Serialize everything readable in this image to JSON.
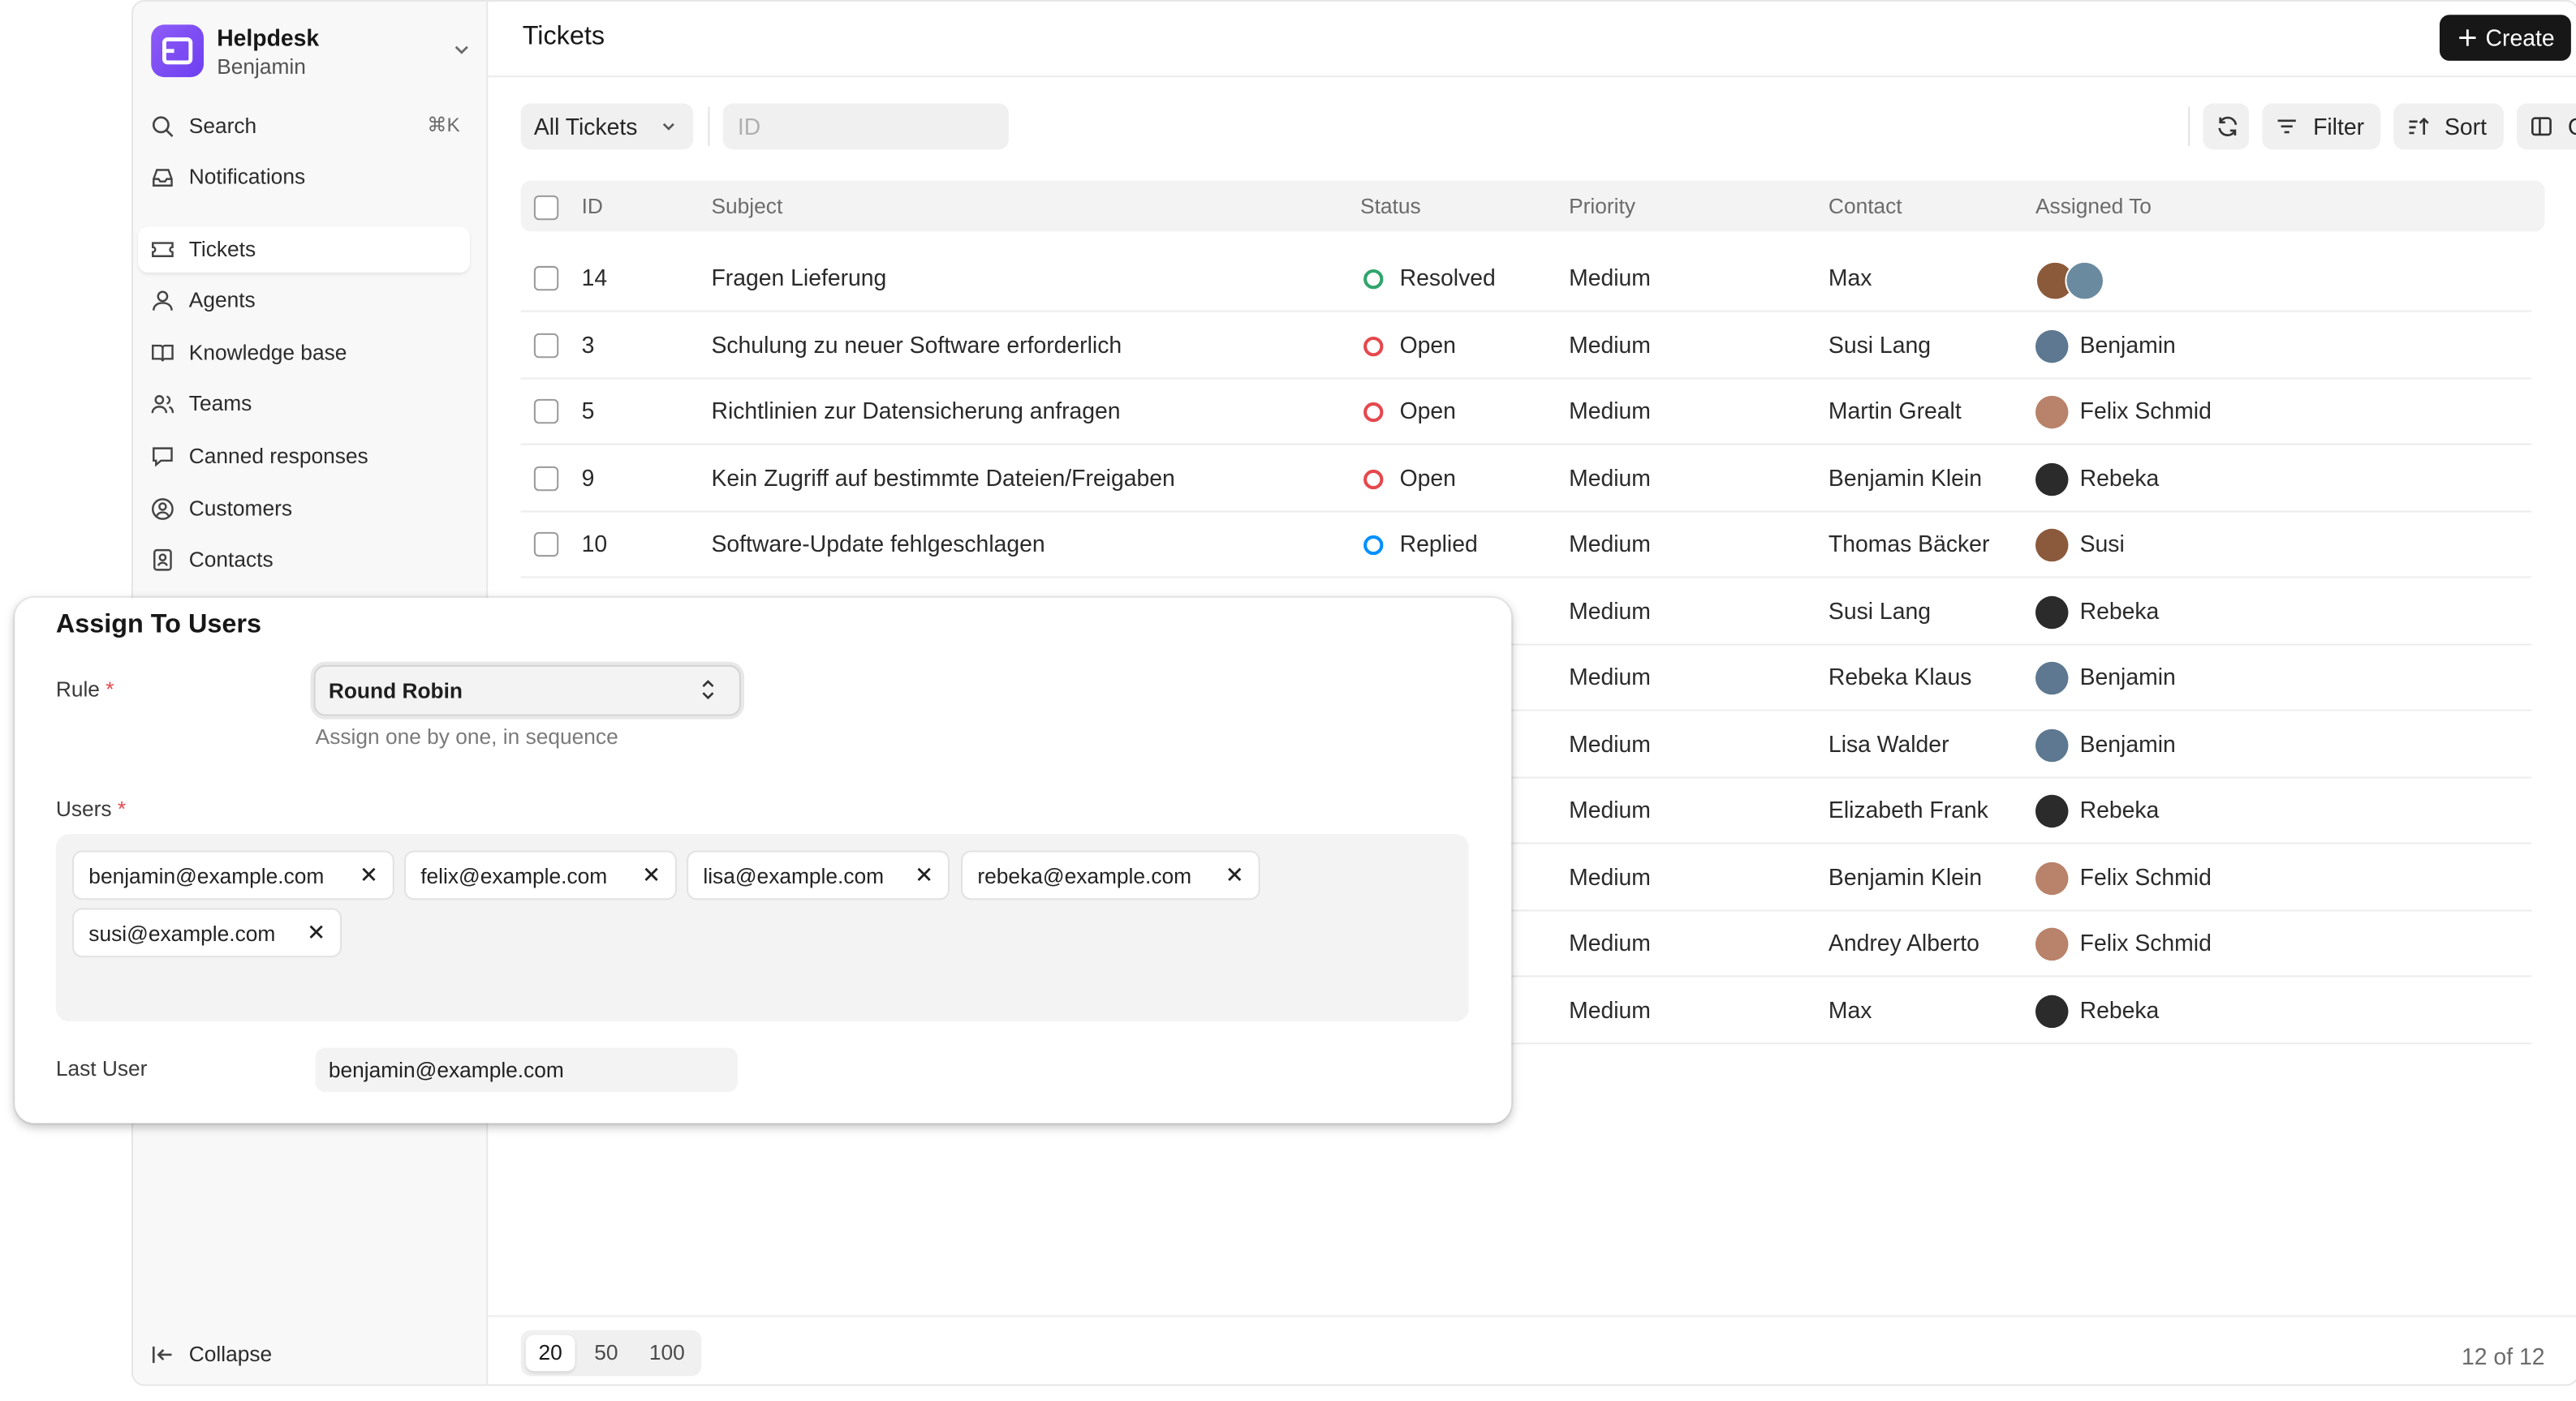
{
  "sidebar": {
    "app_name": "Helpdesk",
    "user_name": "Benjamin",
    "search_label": "Search",
    "search_shortcut": "⌘K",
    "items": [
      {
        "label": "Notifications",
        "icon": "inbox-icon"
      },
      {
        "label": "Tickets",
        "icon": "ticket-icon",
        "active": true
      },
      {
        "label": "Agents",
        "icon": "user-icon"
      },
      {
        "label": "Knowledge base",
        "icon": "book-icon"
      },
      {
        "label": "Teams",
        "icon": "users-icon"
      },
      {
        "label": "Canned responses",
        "icon": "message-icon"
      },
      {
        "label": "Customers",
        "icon": "user-circle-icon"
      },
      {
        "label": "Contacts",
        "icon": "contact-icon"
      }
    ],
    "collapse_label": "Collapse"
  },
  "header": {
    "title": "Tickets",
    "create_label": "Create"
  },
  "toolbar": {
    "view_label": "All Tickets",
    "id_placeholder": "ID",
    "filter_label": "Filter",
    "sort_label": "Sort",
    "columns_label": "Columns"
  },
  "table": {
    "columns": [
      "ID",
      "Subject",
      "Status",
      "Priority",
      "Contact",
      "Assigned To"
    ],
    "rows": [
      {
        "id": "14",
        "subject": "Fragen Lieferung",
        "status": "Resolved",
        "priority": "Medium",
        "contact": "Max",
        "assigned": ""
      },
      {
        "id": "3",
        "subject": "Schulung zu neuer Software erforderlich",
        "status": "Open",
        "priority": "Medium",
        "contact": "Susi Lang",
        "assigned": "Benjamin"
      },
      {
        "id": "5",
        "subject": "Richtlinien zur Datensicherung anfragen",
        "status": "Open",
        "priority": "Medium",
        "contact": "Martin Grealt",
        "assigned": "Felix Schmid"
      },
      {
        "id": "9",
        "subject": "Kein Zugriff auf bestimmte Dateien/Freigaben",
        "status": "Open",
        "priority": "Medium",
        "contact": "Benjamin Klein",
        "assigned": "Rebeka"
      },
      {
        "id": "10",
        "subject": "Software-Update fehlgeschlagen",
        "status": "Replied",
        "priority": "Medium",
        "contact": "Thomas Bäcker",
        "assigned": "Susi"
      },
      {
        "id": "",
        "subject": "",
        "status": "",
        "priority": "Medium",
        "contact": "Susi Lang",
        "assigned": "Rebeka"
      },
      {
        "id": "",
        "subject": "",
        "status": "",
        "priority": "Medium",
        "contact": "Rebeka Klaus",
        "assigned": "Benjamin"
      },
      {
        "id": "",
        "subject": "",
        "status": "",
        "priority": "Medium",
        "contact": "Lisa Walder",
        "assigned": "Benjamin"
      },
      {
        "id": "",
        "subject": "",
        "status": "",
        "priority": "Medium",
        "contact": "Elizabeth Frank",
        "assigned": "Rebeka"
      },
      {
        "id": "",
        "subject": "",
        "status": "",
        "priority": "Medium",
        "contact": "Benjamin Klein",
        "assigned": "Felix Schmid"
      },
      {
        "id": "",
        "subject": "",
        "status": "",
        "priority": "Medium",
        "contact": "Andrey Alberto",
        "assigned": "Felix Schmid"
      },
      {
        "id": "",
        "subject": "",
        "status": "",
        "priority": "Medium",
        "contact": "Max",
        "assigned": "Rebeka"
      }
    ]
  },
  "status_colors": {
    "Resolved": "#30a46c",
    "Open": "#e5484d",
    "Replied": "#0090ff"
  },
  "footer": {
    "page_sizes": [
      "20",
      "50",
      "100"
    ],
    "count_text": "12 of 12"
  },
  "modal": {
    "title": "Assign To Users",
    "rule_label": "Rule",
    "rule_value": "Round Robin",
    "rule_hint": "Assign one by one, in sequence",
    "users_label": "Users",
    "users": [
      "benjamin@example.com",
      "felix@example.com",
      "lisa@example.com",
      "rebeka@example.com",
      "susi@example.com"
    ],
    "last_user_label": "Last User",
    "last_user_value": "benjamin@example.com"
  }
}
